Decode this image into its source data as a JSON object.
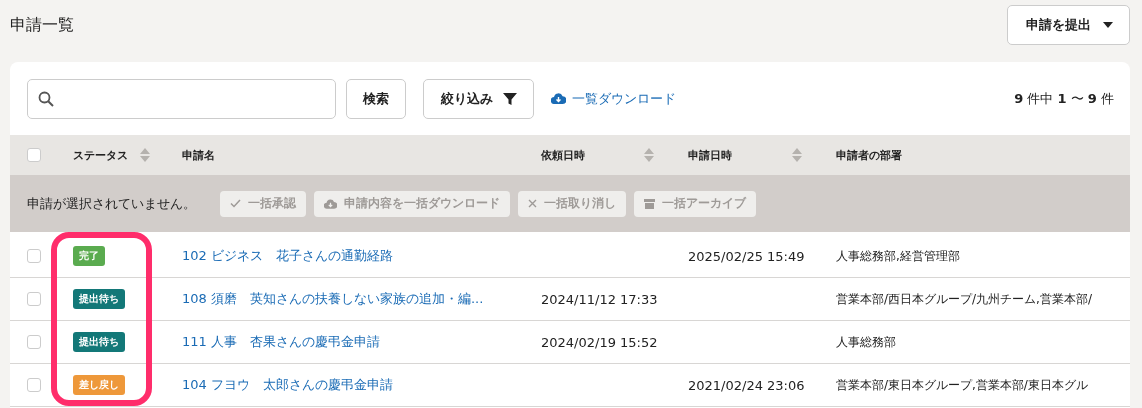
{
  "page_title": "申請一覧",
  "submit_button": {
    "label": "申請を提出"
  },
  "toolbar": {
    "search_button": "検索",
    "filter_button": "絞り込み",
    "download_link": "一覧ダウンロード",
    "count": "**9** 件中 **1** 〜 **9** 件"
  },
  "table": {
    "header_checked": false,
    "columns": [
      {
        "label": "ステータス",
        "sortable": true
      },
      {
        "label": "申請名",
        "sortable": false
      },
      {
        "label": "依頼日時",
        "sortable": true
      },
      {
        "label": "申請日時",
        "sortable": true
      },
      {
        "label": "申請者の部署",
        "sortable": false
      }
    ],
    "bulk_bar": {
      "message": "申請が選択されていません。",
      "actions": [
        {
          "label": "一括承認",
          "disabled": true
        },
        {
          "label": "申請内容を一括ダウンロード",
          "disabled": true
        },
        {
          "label": "一括取り消し",
          "disabled": true
        },
        {
          "label": "一括アーカイブ",
          "disabled": true
        }
      ]
    },
    "rows": [
      {
        "checked": false,
        "status": "完了",
        "color": "#5aab4f",
        "name": "102 ビジネス　花子さんの通勤経路",
        "submitted": "2025/02/25 15:49",
        "department": "人事総務部,経営管理部"
      },
      {
        "checked": false,
        "status": "提出待ち",
        "color": "#137878",
        "name": "108 須磨　英知さんの扶養しない家族の追加・編...",
        "requested": "2024/11/12 17:33",
        "department": "営業本部/西日本グループ/九州チーム,営業本部/"
      },
      {
        "checked": false,
        "status": "提出待ち",
        "color": "#137878",
        "name": "111 人事　杏果さんの慶弔金申請",
        "requested": "2024/02/19 15:52",
        "department": "人事総務部"
      },
      {
        "checked": false,
        "status": "差し戻し",
        "color": "#ee983a",
        "name": "104 フヨウ　太郎さんの慶弔金申請",
        "submitted": "2021/02/24 23:06",
        "department": "営業本部/東日本グループ,営業本部/東日本グル"
      }
    ],
    "status_highlight": true
  }
}
